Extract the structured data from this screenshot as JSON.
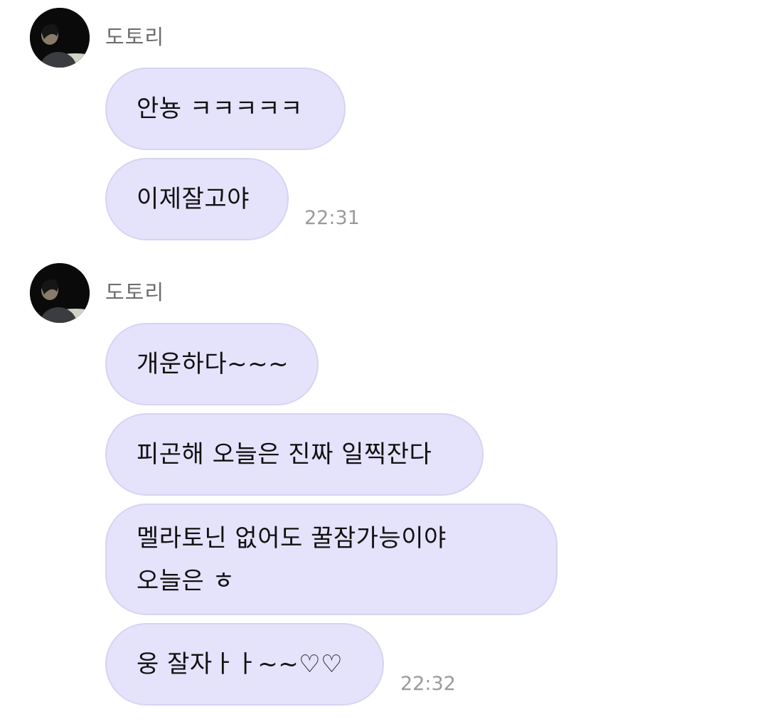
{
  "groups": [
    {
      "sender": "도토리",
      "messages": [
        "안뇽 ㅋㅋㅋㅋㅋ",
        "이제잘고야"
      ],
      "time": "22:31"
    },
    {
      "sender": "도토리",
      "messages": [
        "개운하다~~~",
        "피곤해 오늘은 진짜 일찍잔다",
        "멜라토닌 없어도 꿀잠가능이야\n오늘은 ㅎ",
        "웅 잘자ㅏㅏ~~♡♡"
      ],
      "time": "22:32"
    }
  ]
}
